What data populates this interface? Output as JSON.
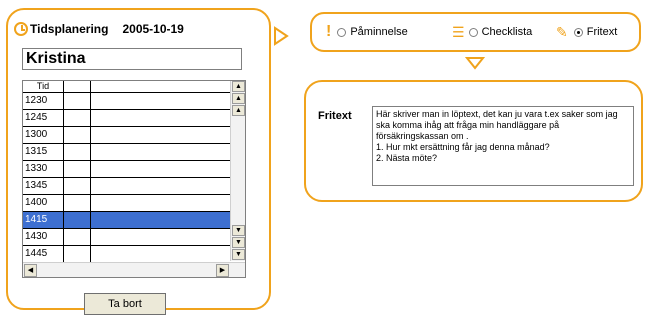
{
  "schedule": {
    "title": "Tidsplanering",
    "date": "2005-10-19",
    "name": "Kristina",
    "column_header": "Tid",
    "rows": [
      {
        "time": "1230",
        "selected": false
      },
      {
        "time": "1245",
        "selected": false
      },
      {
        "time": "1300",
        "selected": false
      },
      {
        "time": "1315",
        "selected": false
      },
      {
        "time": "1330",
        "selected": false
      },
      {
        "time": "1345",
        "selected": false
      },
      {
        "time": "1400",
        "selected": false
      },
      {
        "time": "1415",
        "selected": true
      },
      {
        "time": "1430",
        "selected": false
      },
      {
        "time": "1445",
        "selected": false
      }
    ],
    "delete_label": "Ta bort"
  },
  "options": {
    "items": [
      {
        "label": "Påminnelse",
        "icon": "exclamation-icon",
        "checked": false
      },
      {
        "label": "Checklista",
        "icon": "checklist-icon",
        "checked": false
      },
      {
        "label": "Fritext",
        "icon": "pencil-icon",
        "checked": true
      }
    ]
  },
  "fritext": {
    "label": "Fritext",
    "text": "Här skriver man in löptext, det kan ju vara t.ex saker som jag ska komma ihåg att fråga min handläggare på försäkringskassan om .\n1. Hur mkt ersättning får jag denna månad?\n2. Nästa möte?"
  },
  "colors": {
    "accent": "#f0a31c",
    "selection": "#3d6fd1"
  }
}
